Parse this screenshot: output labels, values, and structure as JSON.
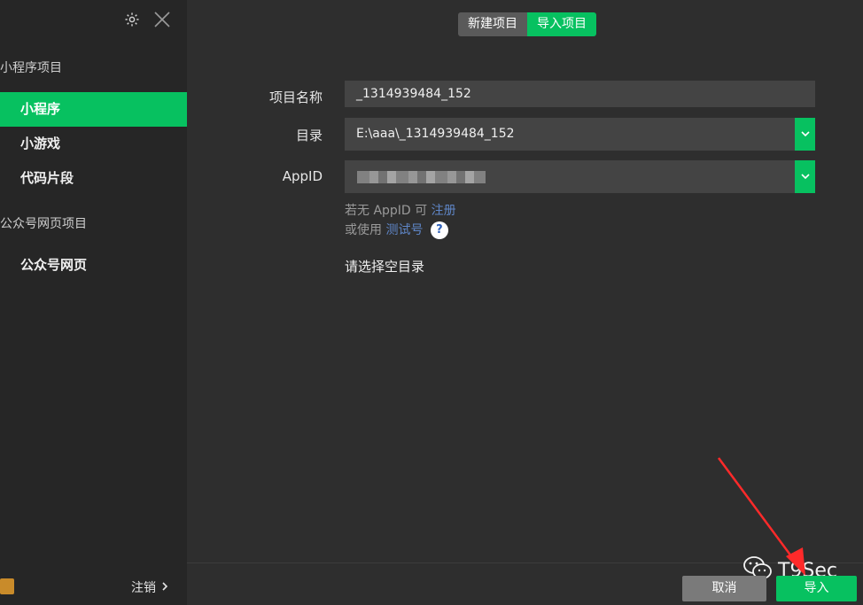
{
  "sidebar": {
    "sections": [
      {
        "title": "小程序项目",
        "items": [
          "小程序",
          "小游戏",
          "代码片段"
        ]
      },
      {
        "title": "公众号网页项目",
        "items": [
          "公众号网页"
        ]
      }
    ],
    "active_item": "小程序",
    "logout_label": "注销"
  },
  "tabs": [
    {
      "label": "新建项目",
      "active": false
    },
    {
      "label": "导入项目",
      "active": true
    }
  ],
  "form": {
    "name_label": "项目名称",
    "name_value": "_1314939484_152",
    "dir_label": "目录",
    "dir_value": "E:\\aaa\\_1314939484_152",
    "appid_label": "AppID",
    "hint1_prefix": "若无 AppID 可",
    "hint1_link": "注册",
    "hint2_prefix": "或使用",
    "hint2_link": "测试号",
    "help_symbol": "?",
    "empty_dir_msg": "请选择空目录"
  },
  "buttons": {
    "cancel": "取消",
    "import": "导入"
  },
  "watermark": "T9Sec",
  "colors": {
    "accent": "#07c160",
    "link": "#5f86c7",
    "annotation_arrow": "#ff2a2a"
  }
}
